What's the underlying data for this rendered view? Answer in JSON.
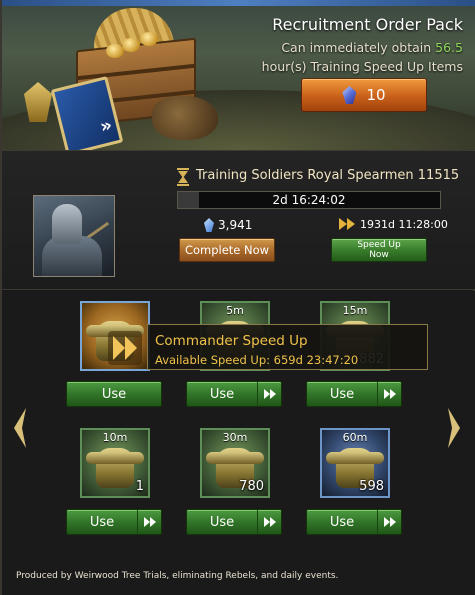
{
  "banner": {
    "title": "Recruitment Order Pack",
    "desc_prefix": "Can immediately obtain",
    "desc_highlight": "56.5",
    "desc_suffix": "hour(s) Training Speed Up Items",
    "price": "10",
    "highlight_color": "#8fd65c"
  },
  "training": {
    "title": "Training Soldiers Royal Spearmen 11515",
    "time_remaining": "2d 16:24:02",
    "gem_cost": "3,941",
    "speedup_total": "1931d 11:28:00",
    "complete_label": "Complete Now",
    "speedup_label_1": "Speed Up",
    "speedup_label_2": "Now"
  },
  "tooltip": {
    "title": "Commander Speed Up",
    "subtitle": "Available Speed Up: 659d 23:47:20"
  },
  "items": [
    {
      "duration": "",
      "qty": "",
      "use_label": "Use",
      "style": "gold",
      "icon": "commander-speedup-icon",
      "fast_forward": false
    },
    {
      "duration": "5m",
      "qty": "",
      "use_label": "Use",
      "style": "green",
      "icon": "training-speedup-icon",
      "fast_forward": true
    },
    {
      "duration": "15m",
      "qty": "882",
      "use_label": "Use",
      "style": "green",
      "icon": "training-speedup-icon",
      "fast_forward": true
    },
    {
      "duration": "10m",
      "qty": "1",
      "use_label": "Use",
      "style": "green",
      "icon": "training-speedup-icon",
      "fast_forward": true
    },
    {
      "duration": "30m",
      "qty": "780",
      "use_label": "Use",
      "style": "green",
      "icon": "training-speedup-icon",
      "fast_forward": true
    },
    {
      "duration": "60m",
      "qty": "598",
      "use_label": "Use",
      "style": "blue",
      "icon": "training-speedup-icon",
      "fast_forward": true
    }
  ],
  "footer": "Produced by Weirwood Tree Trials, eliminating Rebels, and daily events.",
  "colors": {
    "accent_orange": "#c8601a",
    "button_green": "#2f7226",
    "tooltip_gold": "#f0c24a"
  }
}
